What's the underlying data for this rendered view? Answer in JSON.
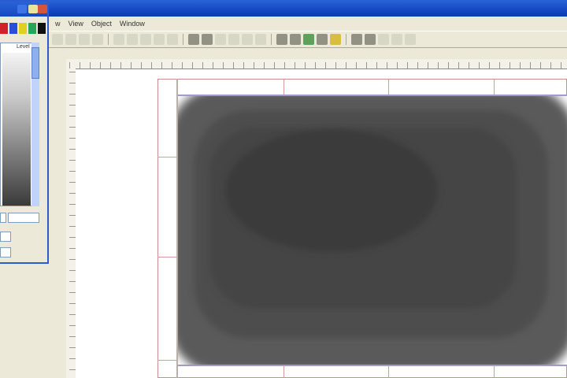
{
  "menu": {
    "items": [
      "w",
      "View",
      "Object",
      "Window"
    ]
  },
  "toolbar": {
    "buttons": [
      "new-icon",
      "open-icon",
      "save-icon",
      "print-icon",
      "cut-icon",
      "copy-icon",
      "paste-icon",
      "undo-icon",
      "redo-icon",
      "zoom-in-icon",
      "zoom-out-icon",
      "select-icon",
      "pan-icon",
      "text-icon",
      "line-icon",
      "rect-icon",
      "ellipse-icon",
      "polygon-icon",
      "fill-icon",
      "contour-icon",
      "surface-icon",
      "legend-icon",
      "grid-icon",
      "axis-icon",
      "scale-icon"
    ]
  },
  "palette": {
    "header_label": "Level",
    "swatches": [
      "#d0202a",
      "#2a4fd6",
      "#e0d020",
      "#26a65b",
      "#111111"
    ]
  },
  "colors": {
    "title_blue": "#1548c4",
    "frame_red": "#d08a8a",
    "axis_violet": "#a39bc6",
    "contour_levels": [
      "#555555",
      "#4a4a4a",
      "#414141",
      "#3a3a3a"
    ]
  }
}
